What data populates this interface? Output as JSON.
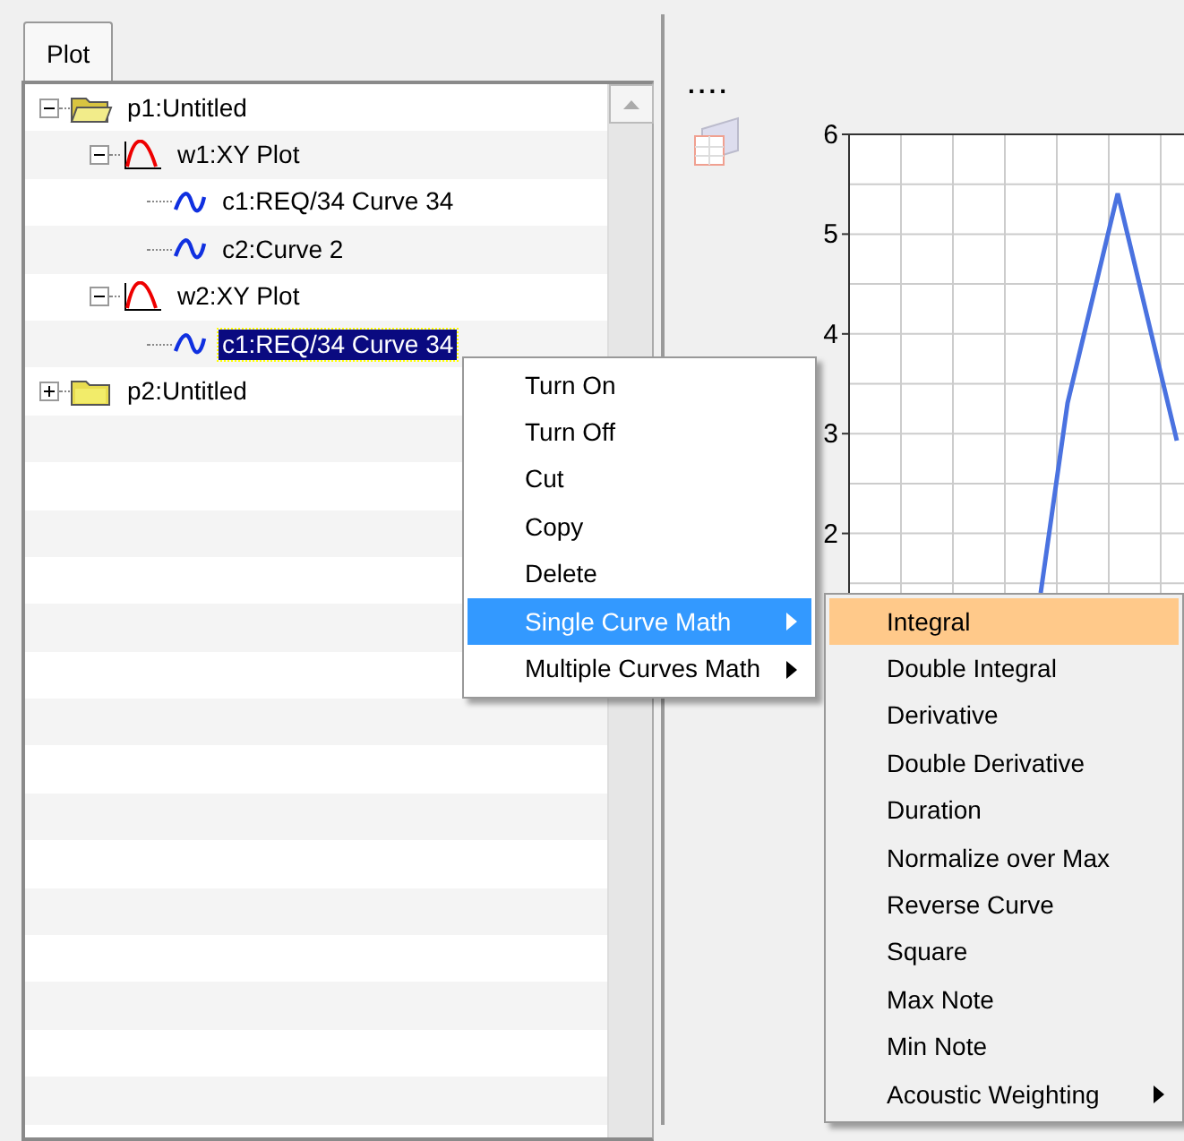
{
  "tabs": [
    {
      "label": "Plot",
      "selected": true
    }
  ],
  "tree": [
    {
      "label": "p1:Untitled",
      "kind": "page",
      "expanded": true,
      "selected": false,
      "children": [
        {
          "label": "w1:XY Plot",
          "kind": "window",
          "expanded": true,
          "selected": false,
          "children": [
            {
              "label": "c1:REQ/34 Curve 34",
              "kind": "curve",
              "selected": false
            },
            {
              "label": "c2:Curve 2",
              "kind": "curve",
              "selected": false
            }
          ]
        },
        {
          "label": "w2:XY Plot",
          "kind": "window",
          "expanded": true,
          "selected": false,
          "children": [
            {
              "label": "c1:REQ/34 Curve 34",
              "kind": "curve",
              "selected": true
            }
          ]
        }
      ]
    },
    {
      "label": "p2:Untitled",
      "kind": "page",
      "expanded": false,
      "selected": false
    }
  ],
  "toolbar": {
    "label": "...."
  },
  "chart": {
    "y_ticks": [
      "6",
      "5",
      "4",
      "3",
      "2"
    ]
  },
  "context_menu": [
    {
      "label": "Turn On",
      "selected": false,
      "submenu": false
    },
    {
      "label": "Turn Off",
      "selected": false,
      "submenu": false
    },
    {
      "label": "Cut",
      "selected": false,
      "submenu": false
    },
    {
      "label": "Copy",
      "selected": false,
      "submenu": false
    },
    {
      "label": "Delete",
      "selected": false,
      "submenu": false
    },
    {
      "label": "Single Curve Math",
      "selected": true,
      "submenu": true
    },
    {
      "label": "Multiple Curves Math",
      "selected": false,
      "submenu": true
    }
  ],
  "submenu": [
    {
      "label": "Integral",
      "selected": true,
      "submenu": false
    },
    {
      "label": "Double Integral",
      "selected": false,
      "submenu": false
    },
    {
      "label": "Derivative",
      "selected": false,
      "submenu": false
    },
    {
      "label": "Double Derivative",
      "selected": false,
      "submenu": false
    },
    {
      "label": "Duration",
      "selected": false,
      "submenu": false
    },
    {
      "label": "Normalize over Max",
      "selected": false,
      "submenu": false
    },
    {
      "label": "Reverse Curve",
      "selected": false,
      "submenu": false
    },
    {
      "label": "Square",
      "selected": false,
      "submenu": false
    },
    {
      "label": "Max Note",
      "selected": false,
      "submenu": false
    },
    {
      "label": "Min Note",
      "selected": false,
      "submenu": false
    },
    {
      "label": "Acoustic Weighting",
      "selected": false,
      "submenu": true
    }
  ]
}
